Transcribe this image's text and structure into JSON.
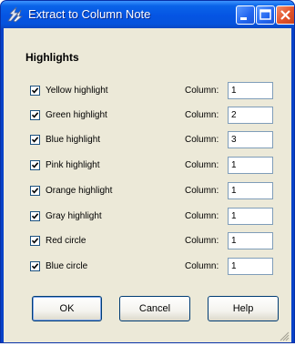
{
  "window": {
    "title": "Extract to Column Note"
  },
  "section": {
    "heading": "Highlights"
  },
  "column_label": "Column:",
  "rows": [
    {
      "label": "Yellow highlight",
      "checked": true,
      "column": "1"
    },
    {
      "label": "Green highlight",
      "checked": true,
      "column": "2"
    },
    {
      "label": "Blue highlight",
      "checked": true,
      "column": "3"
    },
    {
      "label": "Pink highlight",
      "checked": true,
      "column": "1"
    },
    {
      "label": "Orange highlight",
      "checked": true,
      "column": "1"
    },
    {
      "label": "Gray highlight",
      "checked": true,
      "column": "1"
    },
    {
      "label": "Red circle",
      "checked": true,
      "column": "1"
    },
    {
      "label": "Blue circle",
      "checked": true,
      "column": "1"
    }
  ],
  "buttons": {
    "ok": "OK",
    "cancel": "Cancel",
    "help": "Help"
  },
  "colors": {
    "titlebar": "#0554e3",
    "close_button": "#e2522a",
    "dialog_bg": "#ece9d8",
    "checkbox_border": "#1c5180",
    "input_border": "#7f9db9"
  }
}
